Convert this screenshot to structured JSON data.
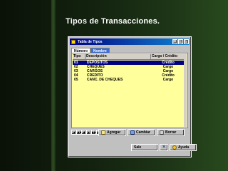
{
  "slide": {
    "title": "Tipos de Transacciones."
  },
  "window": {
    "title": "Tabla de Tipos",
    "minimize": "_",
    "maximize": "□",
    "close": "×"
  },
  "tabs": [
    {
      "label": "Número"
    },
    {
      "label": "Nombre"
    }
  ],
  "grid": {
    "columns": [
      "Tipo",
      "Descripción",
      "Cargo / Crédito"
    ],
    "rows": [
      {
        "tipo": "01",
        "descripcion": "DEPOSITOS",
        "cargo_credito": "Crédito",
        "selected": true
      },
      {
        "tipo": "02",
        "descripcion": "CHEQUES",
        "cargo_credito": "Cargo"
      },
      {
        "tipo": "03",
        "descripcion": "CARGOS",
        "cargo_credito": "Cargo"
      },
      {
        "tipo": "04",
        "descripcion": "CREDITO",
        "cargo_credito": "Crédito"
      },
      {
        "tipo": "05",
        "descripcion": "CANC. DE CHEQUES",
        "cargo_credito": "Cargo"
      }
    ]
  },
  "nav": [
    "|◀",
    "◀◀",
    "◀",
    "▶",
    "▶▶",
    "▶|"
  ],
  "actions": {
    "add": "Agregar",
    "change": "Cambiar",
    "delete": "Borrar"
  },
  "bottom": {
    "exit": "Sale",
    "close_x": "×",
    "help": "Ayuda"
  },
  "colors": {
    "selected_row": "#000080",
    "grid_bg": "#ffff9c",
    "titlebar": "#000080"
  }
}
